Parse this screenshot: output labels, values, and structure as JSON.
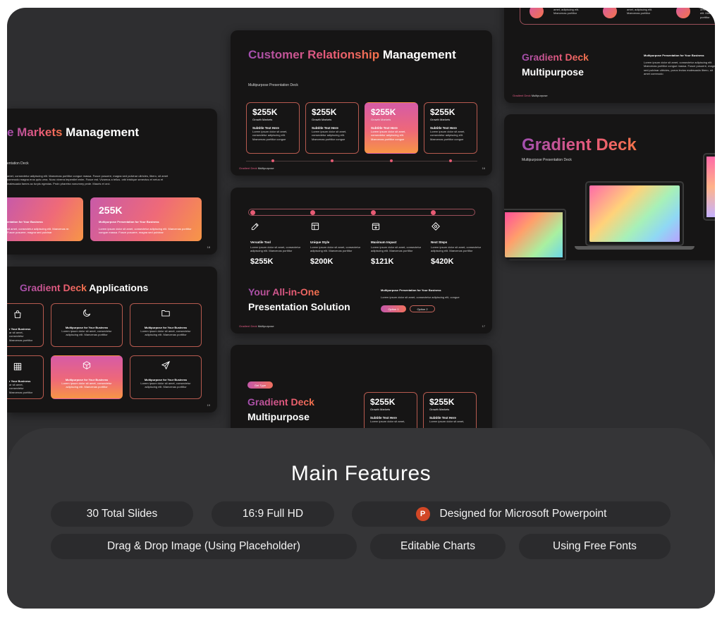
{
  "slides": {
    "crm": {
      "title_grad": "Customer Relationship",
      "title_white": " Management",
      "subtitle": "Multipurpose Presentation Deck",
      "cards": [
        {
          "value": "$255K",
          "label": "Growth Markets",
          "sub": "Subtitle Text Here",
          "text": "Lorem ipsum dolor sit amet, consectetur adipiscing elit. Maecenas porttitor congue"
        },
        {
          "value": "$255K",
          "label": "Growth Markets",
          "sub": "Subtitle Text Here",
          "text": "Lorem ipsum dolor sit amet, consectetur adipiscing elit. Maecenas porttitor congue"
        },
        {
          "value": "$255K",
          "label": "Growth Markets",
          "sub": "Subtitle Text Here",
          "text": "Lorem ipsum dolor sit amet, consectetur adipiscing elit. Maecenas porttitor congue"
        },
        {
          "value": "$255K",
          "label": "Growth Markets",
          "sub": "Subtitle Text Here",
          "text": "Lorem ipsum dolor sit amet, consectetur adipiscing elit. Maecenas porttitor congue"
        }
      ],
      "footer_brand": "Gradient Deck",
      "footer_text": " Multipurpose",
      "page": "16"
    },
    "markets": {
      "title_grad": "e Markets",
      "title_white": " Management",
      "subtitle": "entation Deck",
      "body": "amet, consectetur adipiscing elit. Maecenas porttitor congue massa. Fusce posuere, magna sed pulvinar ultricies, libero, sit amet commodo magna eros quis urna. Nunc viverra imperdiet enim. Fusce est. Vivamus a tellus. orbi tristique senectus et netus et malesuada fames ac turpis egestas. Proin pharetra nonummy pede. Mauris et orci.",
      "card_left_title": "entation for Your Business",
      "card_left_text": "sit amet, consectetur adipiscing elit. Maecenas re. Fusce posuere, magna sed pulvinar",
      "card_right_value": "255K",
      "card_right_title": "Multipurpose Presentation for Your Business",
      "card_right_text": "Lorem ipsum dolor sit amet, consectetur adipiscing elit. Maecenas porttitor congue massa. Fusce posuere, magna sed pulvinar",
      "page": "18"
    },
    "apps": {
      "title_grad": "Gradient Deck",
      "title_white": " Applications",
      "cards": [
        {
          "title": "r Your Business",
          "text": "ar sit amet, consectetur Maecenas porttitor"
        },
        {
          "title": "Multipurpose for Your Business",
          "text": "Lorem ipsum dolor sit amet, consectetur adipiscing elit. Maecenas porttitor"
        },
        {
          "title": "Multipurpose for Your Business",
          "text": "Lorem ipsum dolor sit amet, consectetur adipiscing elit. Maecenas porttitor"
        },
        {
          "title": "r Your Business",
          "text": "ar sit amet, consectetur Maecenas porttitor"
        },
        {
          "title": "Multipurpose for Your Business",
          "text": "Lorem ipsum dolor sit amet, consectetur adipiscing elit. Maecenas porttitor"
        },
        {
          "title": "Multipurpose for Your Business",
          "text": "Lorem ipsum dolor sit amet, consectetur adipiscing elit. Maecenas porttitor"
        }
      ],
      "page": "19"
    },
    "allinone": {
      "cols": [
        {
          "title": "Versatile Tool",
          "text": "Lorem ipsum dolor sit amet, consectetur adipiscing elit. Maecenas porttitor",
          "value": "$255K"
        },
        {
          "title": "Unique Style",
          "text": "Lorem ipsum dolor sit amet, consectetur adipiscing elit. Maecenas porttitor",
          "value": "$200K"
        },
        {
          "title": "Maximum Impact",
          "text": "Lorem ipsum dolor sit amet, consectetur adipiscing elit. Maecenas porttitor",
          "value": "$121K"
        },
        {
          "title": "Next Steps",
          "text": "Lorem ipsum dolor sit amet, consectetur adipiscing elit. Maecenas porttitor",
          "value": "$420K"
        }
      ],
      "title_grad": "Your All-in-One",
      "title_white": "Presentation Solution",
      "right_title": "Multipurpose Presentation for Your Business",
      "right_text": "Lorem ipsum dolor sit amet, consectetur adipiscing elit, congue",
      "option1": "Option 1",
      "option2": "Option 2",
      "footer_brand": "Gradient Deck",
      "footer_text": " Multipurpose",
      "page": "17"
    },
    "multi": {
      "tag": "Get Type",
      "title_grad": "Gradient Deck",
      "title_white": "Multipurpose",
      "cards": [
        {
          "value": "$255K",
          "label": "Growth Markets",
          "sub": "Subtitle Text Here",
          "text": "Lorem ipsum dolor sit amet,"
        },
        {
          "value": "$255K",
          "label": "Growth Markets",
          "sub": "Subtitle Text Here",
          "text": "Lorem ipsum dolor sit amet,"
        }
      ]
    },
    "topright": {
      "partial_texts": [
        "amet, adipiscing elit. Maecenas porttitor",
        "amet, adipiscing elit. Maecenas porttitor",
        "amet, adipiscing elit. Maecenas porttitor"
      ],
      "title_grad": "Gradient Deck",
      "title_white": "Multipurpose",
      "right_title": "Multipurpose Presentation for Your Business",
      "right_text": "Lorem ipsum dolor sit amet, consectetur adipiscing elit. Maecenas porttitor congue massa. Fusce posuere, magna sed pulvinar ultricies, purus lectus malesuada libero, sit amet commodo",
      "footer_brand": "Gradient Deck",
      "footer_text": " Multipurpose"
    },
    "hero": {
      "title": "Gradient Deck",
      "subtitle": "Multipurpose Presentation Deck"
    }
  },
  "features": {
    "title": "Main Features",
    "items": [
      {
        "label": "30 Total Slides"
      },
      {
        "label": "16:9 Full HD"
      },
      {
        "label": "Designed for Microsoft Powerpoint",
        "icon": "powerpoint-icon"
      },
      {
        "label": "Drag & Drop Image (Using Placeholder)"
      },
      {
        "label": "Editable Charts"
      },
      {
        "label": "Using Free Fonts"
      }
    ]
  },
  "colors": {
    "frame": "#2e2e30",
    "panel": "#353537",
    "pill": "#2b2b2d",
    "gradient_start": "#a24fb0",
    "gradient_mid": "#e85a7a",
    "gradient_end": "#f5734a",
    "powerpoint": "#d24726"
  }
}
